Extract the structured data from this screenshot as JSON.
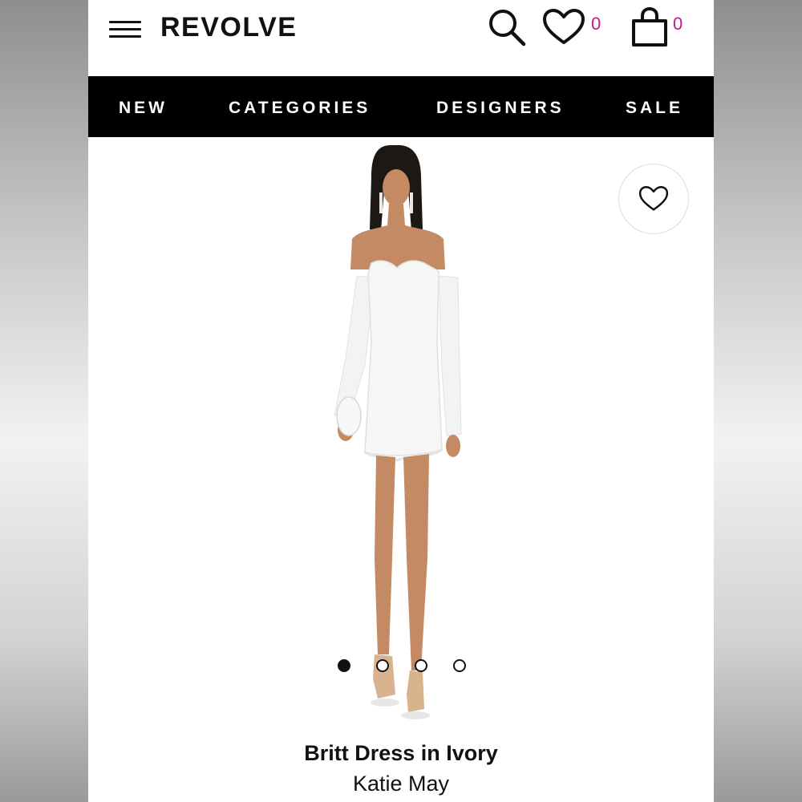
{
  "header": {
    "logo": "REVOLVE",
    "menu_icon": "hamburger-menu-icon",
    "search_icon": "search-icon",
    "wishlist_icon": "heart-icon",
    "wishlist_count": "0",
    "bag_icon": "shopping-bag-icon",
    "bag_count": "0",
    "count_color": "#c2198a"
  },
  "nav": {
    "items": [
      {
        "label": "NEW"
      },
      {
        "label": "CATEGORIES"
      },
      {
        "label": "DESIGNERS"
      },
      {
        "label": "SALE"
      }
    ],
    "background": "#000000",
    "text_color": "#ffffff"
  },
  "product": {
    "favorite_icon": "heart-outline-icon",
    "image": "model-in-white-off-shoulder-lace-mini-dress",
    "carousel": {
      "total": 4,
      "active": 1
    },
    "title": "Britt Dress in Ivory",
    "brand": "Katie May"
  }
}
